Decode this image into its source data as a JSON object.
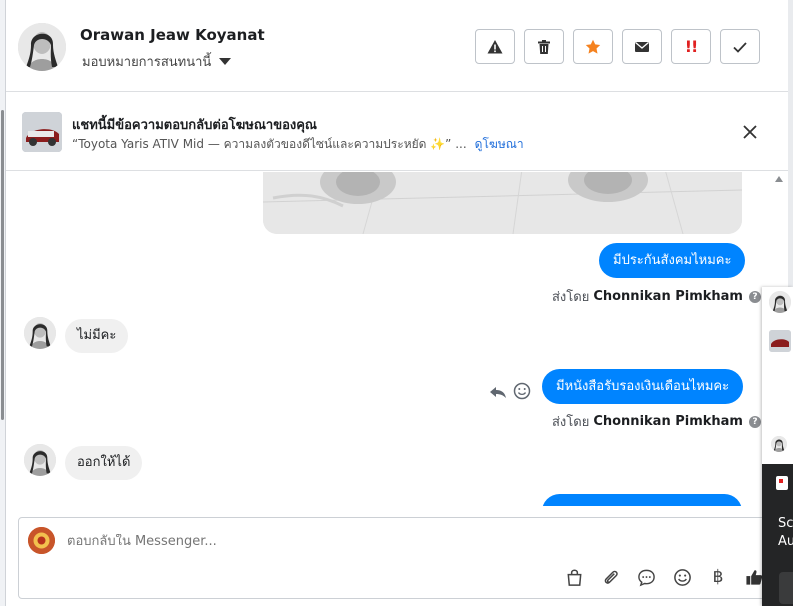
{
  "header": {
    "contact_name": "Orawan Jeaw Koyanat",
    "assign_label": "มอบหมายการสนทนานี้",
    "actions": [
      {
        "name": "report-button",
        "icon": "warning-icon"
      },
      {
        "name": "delete-button",
        "icon": "trash-icon"
      },
      {
        "name": "star-button",
        "icon": "star-icon"
      },
      {
        "name": "mark-unread-button",
        "icon": "envelope-icon"
      },
      {
        "name": "follow-up-button",
        "icon": "double-exclamation-icon",
        "text": "!!"
      },
      {
        "name": "done-button",
        "icon": "check-icon"
      }
    ]
  },
  "ad_banner": {
    "title": "แชทนี้มีข้อความตอบกลับต่อโฆษณาของคุณ",
    "description": "“Toyota Yaris ATIV Mid — ความลงตัวของดีไซน์และความประหยัด ✨” ...",
    "link_label": "ดูโฆษณา"
  },
  "messages": [
    {
      "direction": "out",
      "text": "มีประกันสังคมไหมคะ",
      "sent_by_prefix": "ส่งโดย",
      "sent_by_name": "Chonnikan Pimkham"
    },
    {
      "direction": "in",
      "text": "ไม่มีคะ"
    },
    {
      "direction": "out",
      "text": "มีหนังสือรับรองเงินเดือนไหมคะ",
      "sent_by_prefix": "ส่งโดย",
      "sent_by_name": "Chonnikan Pimkham"
    },
    {
      "direction": "in",
      "text": "ออกให้ได้"
    }
  ],
  "composer": {
    "placeholder": "ตอบกลับใน Messenger...",
    "tools": [
      "shopping-bag-icon",
      "paperclip-icon",
      "saved-reply-icon",
      "emoji-icon",
      "baht-icon",
      "thumbs-up-icon"
    ],
    "baht_symbol": "฿"
  },
  "side_panel": {
    "line1": "Sc",
    "line2": "Au"
  },
  "colors": {
    "accent": "#0084ff",
    "link": "#216fdb",
    "star": "#f5821f",
    "follow_up": "#e02020"
  }
}
